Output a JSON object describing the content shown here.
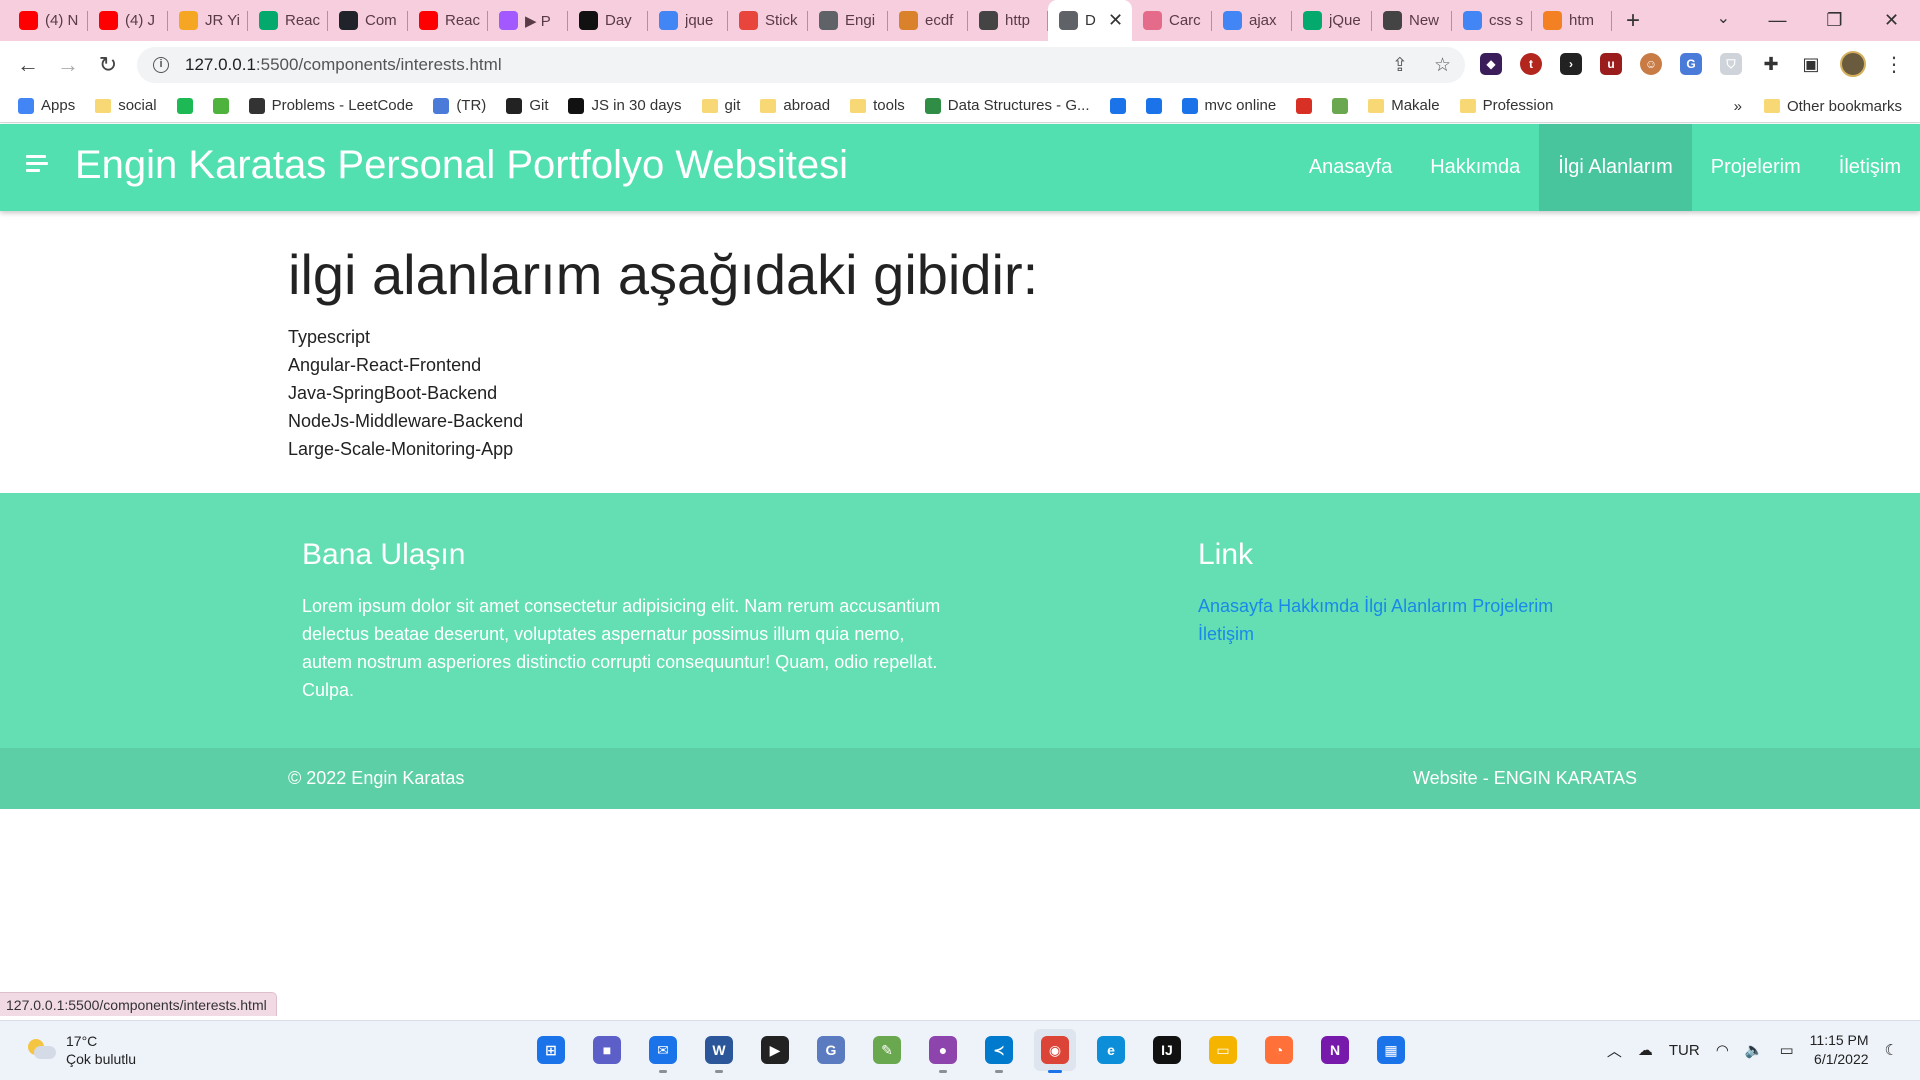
{
  "browser": {
    "tabs": [
      {
        "title": "(4) N",
        "icon": "youtube-icon",
        "color": "#ff0000"
      },
      {
        "title": "(4) J",
        "icon": "youtube-icon",
        "color": "#ff0000"
      },
      {
        "title": "JR Yi",
        "icon": "k-icon",
        "color": "#f5a623"
      },
      {
        "title": "Reac",
        "icon": "w3schools-icon",
        "color": "#04aa6d"
      },
      {
        "title": "Com",
        "icon": "react-icon",
        "color": "#20232a"
      },
      {
        "title": "Reac",
        "icon": "youtube-icon",
        "color": "#ff0000"
      },
      {
        "title": "▶ P",
        "icon": "figma-icon",
        "color": "#a259ff"
      },
      {
        "title": "Day",
        "icon": "hashnode-icon",
        "color": "#111111"
      },
      {
        "title": "jque",
        "icon": "google-icon",
        "color": "#4285f4"
      },
      {
        "title": "Stick",
        "icon": "asterisk-icon",
        "color": "#e8453c"
      },
      {
        "title": "Engi",
        "icon": "globe-icon",
        "color": "#5f6368"
      },
      {
        "title": "ecdf",
        "icon": "mn-icon",
        "color": "#d9822b"
      },
      {
        "title": "http",
        "icon": "tool-icon",
        "color": "#444444"
      },
      {
        "title": "D",
        "icon": "globe-icon",
        "color": "#5f6368",
        "active": true
      },
      {
        "title": "Carc",
        "icon": "codepen-icon",
        "color": "#e56b8a"
      },
      {
        "title": "ajax",
        "icon": "google-icon",
        "color": "#4285f4"
      },
      {
        "title": "jQue",
        "icon": "w3schools-icon",
        "color": "#04aa6d"
      },
      {
        "title": "New",
        "icon": "chrome-icon",
        "color": "#444444"
      },
      {
        "title": "css s",
        "icon": "google-icon",
        "color": "#4285f4"
      },
      {
        "title": "htm",
        "icon": "stackoverflow-icon",
        "color": "#f48024"
      }
    ],
    "url_host": "127.0.0.1",
    "url_rest": ":5500/components/interests.html",
    "bookmarks": [
      {
        "label": "Apps",
        "icon": "apps-icon",
        "color": "#4285f4"
      },
      {
        "label": "social",
        "icon": "folder-icon",
        "color": "#f8d775"
      },
      {
        "label": "",
        "icon": "spotify-icon",
        "color": "#1db954"
      },
      {
        "label": "",
        "icon": "mongodb-icon",
        "color": "#4db33d"
      },
      {
        "label": "Problems - LeetCode",
        "icon": "leetcode-icon",
        "color": "#333333"
      },
      {
        "label": "(TR)",
        "icon": "translate-icon",
        "color": "#4a7bd8"
      },
      {
        "label": "Git",
        "icon": "github-icon",
        "color": "#222222"
      },
      {
        "label": "JS in 30 days",
        "icon": "js30-icon",
        "color": "#111111"
      },
      {
        "label": "git",
        "icon": "folder-icon",
        "color": "#f8d775"
      },
      {
        "label": "abroad",
        "icon": "folder-icon",
        "color": "#f8d775"
      },
      {
        "label": "tools",
        "icon": "folder-icon",
        "color": "#f8d775"
      },
      {
        "label": "Data Structures - G...",
        "icon": "geeksforgeeks-icon",
        "color": "#2f8d46"
      },
      {
        "label": "",
        "icon": "x-icon",
        "color": "#1a73e8"
      },
      {
        "label": "",
        "icon": "html5-icon",
        "color": "#1a73e8"
      },
      {
        "label": "mvc online",
        "icon": "cloud-icon",
        "color": "#1a73e8"
      },
      {
        "label": "",
        "icon": "gmail-icon",
        "color": "#d93025"
      },
      {
        "label": "",
        "icon": "bar-icon",
        "color": "#6aa84f"
      },
      {
        "label": "Makale",
        "icon": "folder-icon",
        "color": "#f8d775"
      },
      {
        "label": "Profession",
        "icon": "folder-icon",
        "color": "#f8d775"
      }
    ],
    "bookmarks_more": "»",
    "other_bookmarks": "Other bookmarks",
    "status_url": "127.0.0.1:5500/components/interests.html"
  },
  "site": {
    "brand": "Engin Karatas Personal Portfolyo Websitesi",
    "nav": [
      "Anasayfa",
      "Hakkımda",
      "İlgi Alanlarım",
      "Projelerim",
      "İletişim"
    ],
    "active_nav": "İlgi Alanlarım",
    "heading": "ilgi alanlarım aşağıdaki gibidir:",
    "interests": [
      "Typescript",
      "Angular-React-Frontend",
      "Java-SpringBoot-Backend",
      "NodeJs-Middleware-Backend",
      "Large-Scale-Monitoring-App"
    ],
    "footer": {
      "contact_title": "Bana Ulaşın",
      "contact_text": "Lorem ipsum dolor sit amet consectetur adipisicing elit. Nam rerum accusantium delectus beatae deserunt, voluptates aspernatur possimus illum quia nemo, autem nostrum asperiores distinctio corrupti consequuntur! Quam, odio repellat. Culpa.",
      "links_title": "Link",
      "links": [
        "Anasayfa",
        "Hakkımda",
        "İlgi Alanlarım",
        "Projelerim",
        "İletişim"
      ],
      "copyright": "© 2022 Engin Karatas",
      "right_text": "Website - ENGIN KARATAS"
    },
    "colors": {
      "nav": "#53e0b1",
      "footer": "#64dfb4",
      "footer_bottom": "#5dcfa6",
      "link": "#1a88e8"
    }
  },
  "taskbar": {
    "temperature": "17°C",
    "weather": "Çok bulutlu",
    "language": "TUR",
    "time": "11:15 PM",
    "date": "6/1/2022",
    "apps": [
      {
        "name": "windows-start-icon",
        "glyph": "⊞",
        "color": "#1a73e8"
      },
      {
        "name": "teams-chat-icon",
        "glyph": "■",
        "color": "#5b5fc7"
      },
      {
        "name": "mail-icon",
        "glyph": "✉",
        "color": "#1a73e8"
      },
      {
        "name": "word-icon",
        "glyph": "W",
        "color": "#2b579a"
      },
      {
        "name": "media-player-icon",
        "glyph": "▶",
        "color": "#222222"
      },
      {
        "name": "github-desktop-icon",
        "glyph": "G",
        "color": "#5a7bbf"
      },
      {
        "name": "image-editor-icon",
        "glyph": "✎",
        "color": "#6aa84f"
      },
      {
        "name": "github-icon",
        "glyph": "●",
        "color": "#8e44ad"
      },
      {
        "name": "vscode-icon",
        "glyph": "≺",
        "color": "#007acc"
      },
      {
        "name": "chrome-icon",
        "glyph": "◉",
        "color": "#db4437",
        "active": true
      },
      {
        "name": "edge-icon",
        "glyph": "e",
        "color": "#0c8fd8"
      },
      {
        "name": "intellij-icon",
        "glyph": "IJ",
        "color": "#111111"
      },
      {
        "name": "file-explorer-icon",
        "glyph": "▭",
        "color": "#f4b400"
      },
      {
        "name": "firefox-icon",
        "glyph": "◔",
        "color": "#ff7139"
      },
      {
        "name": "onenote-icon",
        "glyph": "N",
        "color": "#7719aa"
      },
      {
        "name": "calendar-icon",
        "glyph": "▦",
        "color": "#1a73e8"
      }
    ]
  }
}
